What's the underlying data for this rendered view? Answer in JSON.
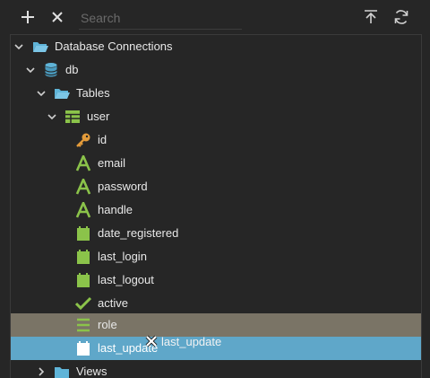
{
  "toolbar": {
    "add_icon": "plus-icon",
    "close_icon": "close-icon",
    "search_placeholder": "Search",
    "collapse_icon": "collapse-to-top-icon",
    "refresh_icon": "refresh-icon"
  },
  "tree": {
    "root_label": "Database Connections",
    "db_label": "db",
    "tables_label": "Tables",
    "table_label": "user",
    "columns": [
      {
        "label": "id",
        "icon": "key-icon"
      },
      {
        "label": "email",
        "icon": "text-type-icon"
      },
      {
        "label": "password",
        "icon": "text-type-icon"
      },
      {
        "label": "handle",
        "icon": "text-type-icon"
      },
      {
        "label": "date_registered",
        "icon": "calendar-icon"
      },
      {
        "label": "last_login",
        "icon": "calendar-icon"
      },
      {
        "label": "last_logout",
        "icon": "calendar-icon"
      },
      {
        "label": "active",
        "icon": "checkmark-icon"
      },
      {
        "label": "role",
        "icon": "list-icon"
      },
      {
        "label": "last_update",
        "icon": "calendar-icon"
      }
    ],
    "views_label": "Views"
  },
  "drag": {
    "label": "last_update",
    "icon": "drag-no-drop-icon"
  },
  "colors": {
    "background": "#262626",
    "hover_row": "#7a7466",
    "selected_row": "#5fa7c9",
    "folder": "#5fb4d8",
    "table": "#8bc34a",
    "key": "#e39b3a",
    "type": "#8bc34a"
  }
}
